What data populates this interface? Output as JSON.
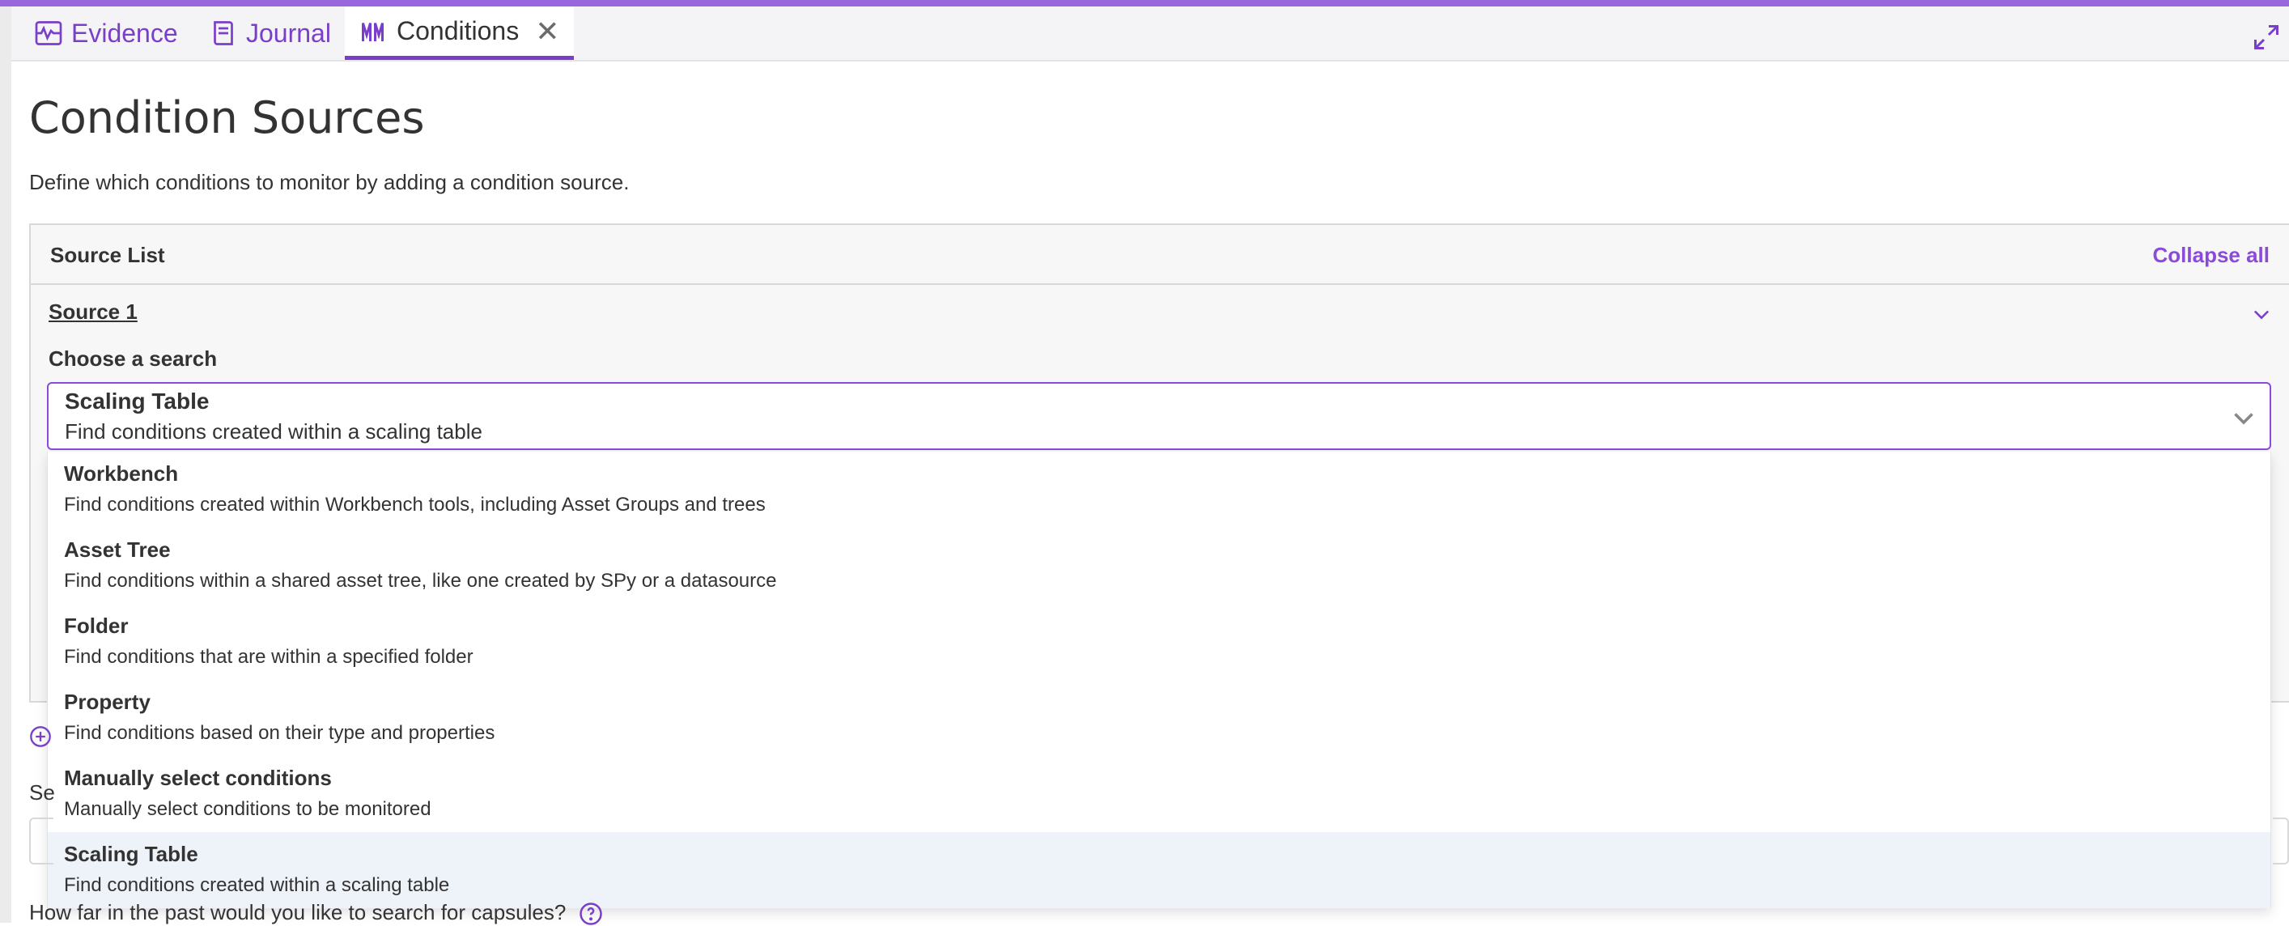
{
  "tabs": [
    {
      "label": "Evidence",
      "icon": "chart-icon"
    },
    {
      "label": "Journal",
      "icon": "journal-icon"
    },
    {
      "label": "Conditions",
      "icon": "conditions-icon",
      "close": "✕"
    }
  ],
  "page": {
    "title": "Condition Sources",
    "description": "Define which conditions to monitor by adding a condition source."
  },
  "source_list": {
    "title": "Source List",
    "collapse_label": "Collapse all",
    "source": {
      "title": "Source 1",
      "choose_label": "Choose a search",
      "selected": {
        "title": "Scaling Table",
        "subtitle": "Find conditions created within a scaling table"
      },
      "options": [
        {
          "title": "Workbench",
          "subtitle": "Find conditions created within Workbench tools, including Asset Groups and trees"
        },
        {
          "title": "Asset Tree",
          "subtitle": "Find conditions within a shared asset tree, like one created by SPy or a datasource"
        },
        {
          "title": "Folder",
          "subtitle": "Find conditions that are within a specified folder"
        },
        {
          "title": "Property",
          "subtitle": "Find conditions based on their type and properties"
        },
        {
          "title": "Manually select conditions",
          "subtitle": "Manually select conditions to be monitored"
        },
        {
          "title": "Scaling Table",
          "subtitle": "Find conditions created within a scaling table"
        }
      ]
    }
  },
  "below": {
    "partial_label": "Se",
    "question": "How far in the past would you like to search for capsules?"
  },
  "colors": {
    "accent": "#8b4ad8",
    "topbar": "#9966dd",
    "selected_bg": "#eef2f9"
  }
}
